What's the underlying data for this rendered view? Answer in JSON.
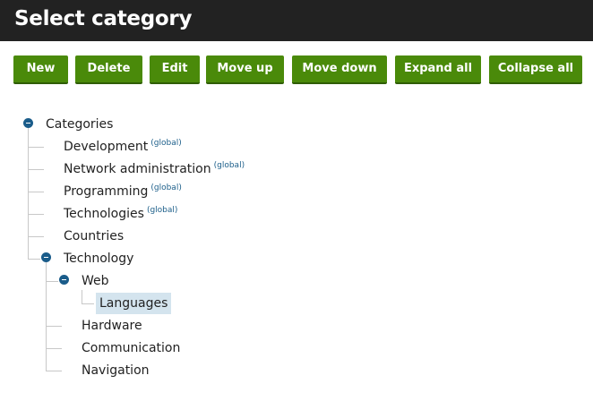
{
  "header": {
    "title": "Select category"
  },
  "toolbar": {
    "new": "New",
    "delete": "Delete",
    "edit": "Edit",
    "move_up": "Move up",
    "move_down": "Move down",
    "expand_all": "Expand all",
    "collapse_all": "Collapse all"
  },
  "tree": {
    "root": "Categories",
    "global_tag": "(global)",
    "development": "Development",
    "network_administration": "Network administration",
    "programming": "Programming",
    "technologies": "Technologies",
    "countries": "Countries",
    "technology": "Technology",
    "web": "Web",
    "languages": "Languages",
    "hardware": "Hardware",
    "communication": "Communication",
    "navigation": "Navigation"
  },
  "colors": {
    "header_bg": "#222222",
    "button_bg": "#4a8a0a",
    "toggle": "#1a5c8a",
    "selected_bg": "#d4e4ee",
    "global_tag": "#1d5f8a"
  }
}
